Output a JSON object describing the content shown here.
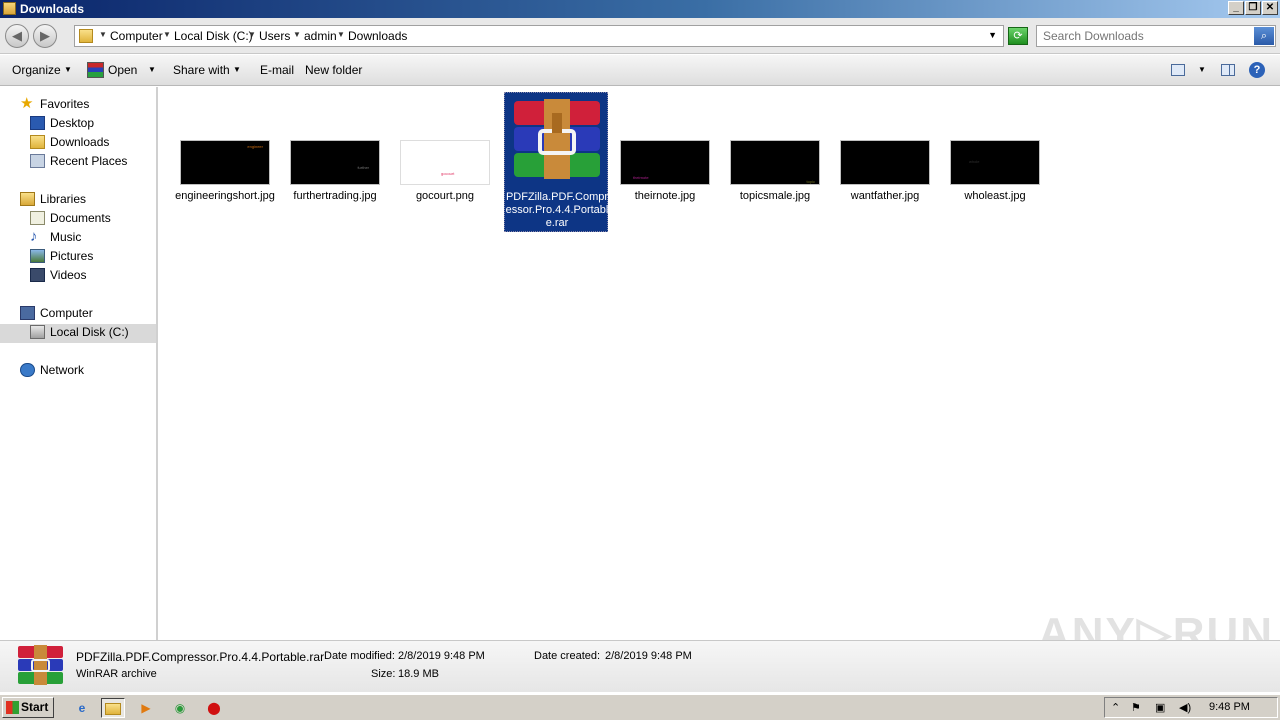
{
  "window": {
    "title": "Downloads",
    "buttons": {
      "minimize": "_",
      "maximize": "❐",
      "close": "✕"
    }
  },
  "address": {
    "breadcrumbs": [
      "Computer",
      "Local Disk (C:)",
      "Users",
      "admin",
      "Downloads"
    ],
    "search_placeholder": "Search Downloads"
  },
  "toolbar": {
    "organize": "Organize",
    "open": "Open",
    "share_with": "Share with",
    "email": "E-mail",
    "new_folder": "New folder"
  },
  "nav": {
    "favorites": "Favorites",
    "desktop": "Desktop",
    "downloads": "Downloads",
    "recent_places": "Recent Places",
    "libraries": "Libraries",
    "documents": "Documents",
    "music": "Music",
    "pictures": "Pictures",
    "videos": "Videos",
    "computer": "Computer",
    "local_disk": "Local Disk (C:)",
    "network": "Network"
  },
  "files": [
    {
      "name": "engineeringshort.jpg",
      "thumb_text": "engineer",
      "thumb_color": "#c86a10"
    },
    {
      "name": "furthertrading.jpg",
      "thumb_text": "further",
      "thumb_color": "#555555"
    },
    {
      "name": "gocourt.png",
      "thumb_text": "gocourt",
      "thumb_color": "#e03060"
    },
    {
      "name": "PDFZilla.PDF.Compressor.Pro.4.4.Portable.rar",
      "selected": true
    },
    {
      "name": "theirnote.jpg",
      "thumb_text": "theirnote",
      "thumb_color": "#b02090"
    },
    {
      "name": "topicsmale.jpg",
      "thumb_text": "topic",
      "thumb_color": "#707020"
    },
    {
      "name": "wantfather.jpg",
      "thumb_text": "",
      "thumb_color": "#000000"
    },
    {
      "name": "wholeast.jpg",
      "thumb_text": "whole",
      "thumb_color": "#303030"
    }
  ],
  "details": {
    "file_name": "PDFZilla.PDF.Compressor.Pro.4.4.Portable.rar",
    "file_type": "WinRAR archive",
    "date_modified_label": "Date modified:",
    "date_modified": "2/8/2019 9:48 PM",
    "size_label": "Size:",
    "size": "18.9 MB",
    "date_created_label": "Date created:",
    "date_created": "2/8/2019 9:48 PM"
  },
  "watermark": "ANY▷RUN",
  "taskbar": {
    "start": "Start",
    "clock": "9:48 PM"
  }
}
